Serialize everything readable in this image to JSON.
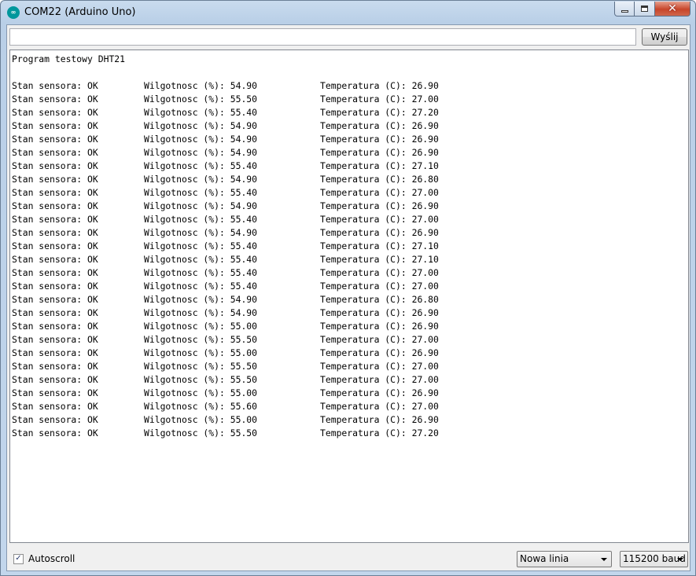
{
  "window": {
    "title": "COM22 (Arduino Uno)",
    "icon": "arduino-icon",
    "controls": {
      "minimize": "minimize-icon",
      "maximize": "maximize-icon",
      "close": "✕"
    }
  },
  "send": {
    "input_value": "",
    "button_label": "Wyślij"
  },
  "output": {
    "header": "Program testowy DHT21",
    "rows": [
      [
        "Stan sensora: OK",
        "Wilgotnosc (%): 54.90",
        "Temperatura (C): 26.90"
      ],
      [
        "Stan sensora: OK",
        "Wilgotnosc (%): 55.50",
        "Temperatura (C): 27.00"
      ],
      [
        "Stan sensora: OK",
        "Wilgotnosc (%): 55.40",
        "Temperatura (C): 27.20"
      ],
      [
        "Stan sensora: OK",
        "Wilgotnosc (%): 54.90",
        "Temperatura (C): 26.90"
      ],
      [
        "Stan sensora: OK",
        "Wilgotnosc (%): 54.90",
        "Temperatura (C): 26.90"
      ],
      [
        "Stan sensora: OK",
        "Wilgotnosc (%): 54.90",
        "Temperatura (C): 26.90"
      ],
      [
        "Stan sensora: OK",
        "Wilgotnosc (%): 55.40",
        "Temperatura (C): 27.10"
      ],
      [
        "Stan sensora: OK",
        "Wilgotnosc (%): 54.90",
        "Temperatura (C): 26.80"
      ],
      [
        "Stan sensora: OK",
        "Wilgotnosc (%): 55.40",
        "Temperatura (C): 27.00"
      ],
      [
        "Stan sensora: OK",
        "Wilgotnosc (%): 54.90",
        "Temperatura (C): 26.90"
      ],
      [
        "Stan sensora: OK",
        "Wilgotnosc (%): 55.40",
        "Temperatura (C): 27.00"
      ],
      [
        "Stan sensora: OK",
        "Wilgotnosc (%): 54.90",
        "Temperatura (C): 26.90"
      ],
      [
        "Stan sensora: OK",
        "Wilgotnosc (%): 55.40",
        "Temperatura (C): 27.10"
      ],
      [
        "Stan sensora: OK",
        "Wilgotnosc (%): 55.40",
        "Temperatura (C): 27.10"
      ],
      [
        "Stan sensora: OK",
        "Wilgotnosc (%): 55.40",
        "Temperatura (C): 27.00"
      ],
      [
        "Stan sensora: OK",
        "Wilgotnosc (%): 55.40",
        "Temperatura (C): 27.00"
      ],
      [
        "Stan sensora: OK",
        "Wilgotnosc (%): 54.90",
        "Temperatura (C): 26.80"
      ],
      [
        "Stan sensora: OK",
        "Wilgotnosc (%): 54.90",
        "Temperatura (C): 26.90"
      ],
      [
        "Stan sensora: OK",
        "Wilgotnosc (%): 55.00",
        "Temperatura (C): 26.90"
      ],
      [
        "Stan sensora: OK",
        "Wilgotnosc (%): 55.50",
        "Temperatura (C): 27.00"
      ],
      [
        "Stan sensora: OK",
        "Wilgotnosc (%): 55.00",
        "Temperatura (C): 26.90"
      ],
      [
        "Stan sensora: OK",
        "Wilgotnosc (%): 55.50",
        "Temperatura (C): 27.00"
      ],
      [
        "Stan sensora: OK",
        "Wilgotnosc (%): 55.50",
        "Temperatura (C): 27.00"
      ],
      [
        "Stan sensora: OK",
        "Wilgotnosc (%): 55.00",
        "Temperatura (C): 26.90"
      ],
      [
        "Stan sensora: OK",
        "Wilgotnosc (%): 55.60",
        "Temperatura (C): 27.00"
      ],
      [
        "Stan sensora: OK",
        "Wilgotnosc (%): 55.00",
        "Temperatura (C): 26.90"
      ],
      [
        "Stan sensora: OK",
        "Wilgotnosc (%): 55.50",
        "Temperatura (C): 27.20"
      ]
    ]
  },
  "footer": {
    "autoscroll_label": "Autoscroll",
    "autoscroll_checked": true,
    "autoscroll_check": "✓",
    "line_ending": "Nowa linia",
    "baud_rate": "115200 baud"
  },
  "colors": {
    "titlebar": "#b9cfe7",
    "close_button": "#c7452a",
    "arduino_teal": "#00979c"
  }
}
